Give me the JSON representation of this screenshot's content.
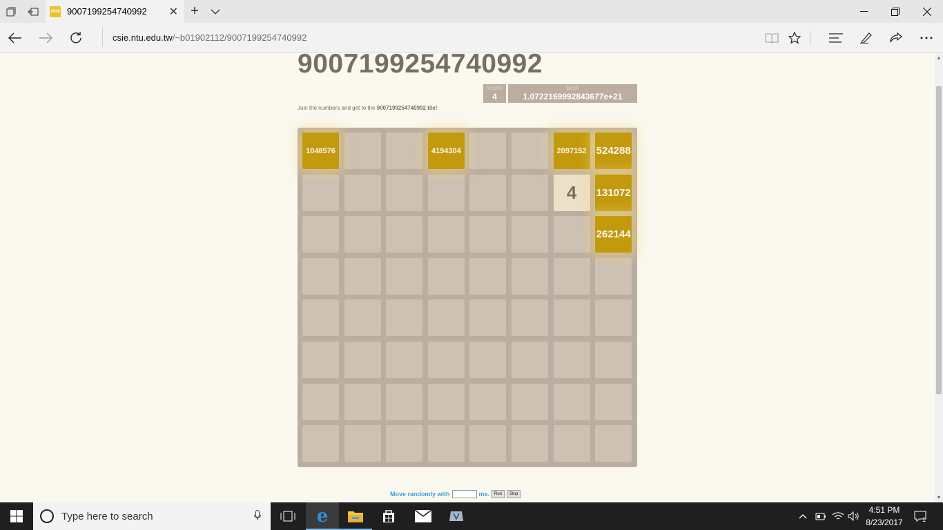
{
  "browser": {
    "tab_title": "9007199254740992",
    "favicon_text": "2048",
    "url_host": "csie.ntu.edu.tw",
    "url_path": "/~b01902112/9007199254740992"
  },
  "game": {
    "title": "9007199254740992",
    "score_label": "SCORE",
    "score_value": "4",
    "best_label": "BEST",
    "best_value": "1.0722169992843677e+21",
    "intro_prefix": "Join the numbers and get to the ",
    "intro_target": "9007199254740992 tile!",
    "board_size": 8,
    "tiles": [
      {
        "row": 0,
        "col": 0,
        "value": "1048576"
      },
      {
        "row": 0,
        "col": 3,
        "value": "4194304"
      },
      {
        "row": 0,
        "col": 6,
        "value": "2097152"
      },
      {
        "row": 0,
        "col": 7,
        "value": "524288"
      },
      {
        "row": 1,
        "col": 6,
        "value": "4"
      },
      {
        "row": 1,
        "col": 7,
        "value": "131072"
      },
      {
        "row": 2,
        "col": 7,
        "value": "262144"
      }
    ],
    "move_randomly_label": "Move randomly with",
    "ms_label": "ms.",
    "run_label": "Run",
    "stop_label": "Stop"
  },
  "taskbar": {
    "search_placeholder": "Type here to search",
    "time": "4:51 PM",
    "date": "8/23/2017",
    "notification_count": "1"
  },
  "colors": {
    "tile_big": "#c39a0d",
    "tile_4": "#ede0c8",
    "board": "#bbada0",
    "cell": "#cdc1b4",
    "title_text": "#776e65",
    "link_blue": "#3aa0dc"
  }
}
